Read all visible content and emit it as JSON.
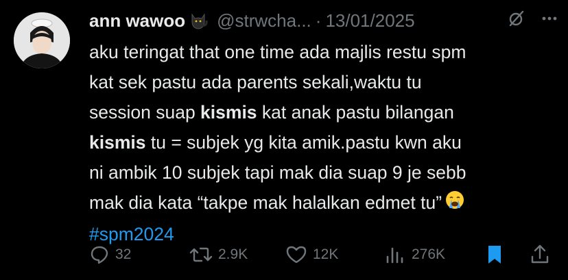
{
  "author": {
    "name": "ann wawoo",
    "handle": "@strwcha...",
    "separator": "·",
    "date": "13/01/2025"
  },
  "tweet": {
    "line1": "aku teringat that one time ada majlis restu spm",
    "line2": "kat sek pastu ada parents sekali,waktu tu",
    "line3_pre": "session suap ",
    "line3_bold": "kismis",
    "line3_post": " kat anak pastu bilangan",
    "line4_bold": "kismis",
    "line4_post": " tu = subjek yg kita amik.pastu kwn aku",
    "line5": "ni ambik 10 subjek tapi mak dia suap 9 je sebb",
    "line6": "mak dia kata “takpe mak halalkan edmet tu”",
    "hashtag": "#spm2024"
  },
  "actions": {
    "replies": "32",
    "reposts": "2.9K",
    "likes": "12K",
    "views": "276K"
  },
  "colors": {
    "background": "#000000",
    "text": "#e7e9ea",
    "muted": "#71767b",
    "accent": "#1d9bf0"
  },
  "icons": [
    "cat-emoji-icon",
    "grok-icon",
    "more-icon",
    "reply-icon",
    "repost-icon",
    "like-icon",
    "views-icon",
    "bookmark-icon",
    "share-icon",
    "crying-emoji-icon"
  ]
}
